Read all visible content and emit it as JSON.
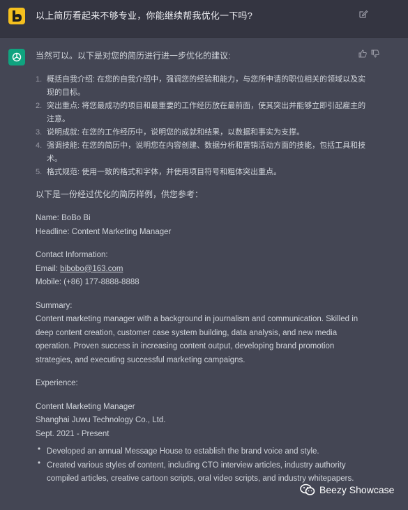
{
  "user_message": {
    "text": "以上简历看起来不够专业，你能继续帮我优化一下吗?"
  },
  "assistant": {
    "intro": "当然可以。以下是对您的简历进行进一步优化的建议:",
    "suggestions": [
      {
        "num": "1.",
        "text": "概括自我介绍: 在您的自我介绍中，强调您的经验和能力，与您所申请的职位相关的领域以及实现的目标。"
      },
      {
        "num": "2.",
        "text": "突出重点: 将您最成功的项目和最重要的工作经历放在最前面，使其突出并能够立即引起雇主的注意。"
      },
      {
        "num": "3.",
        "text": "说明成就: 在您的工作经历中，说明您的成就和结果，以数据和事实为支撑。"
      },
      {
        "num": "4.",
        "text": "强调技能: 在您的简历中，说明您在内容创建、数据分析和营销活动方面的技能，包括工具和技术。"
      },
      {
        "num": "5.",
        "text": "格式规范: 使用一致的格式和字体，并使用项目符号和粗体突出重点。"
      }
    ],
    "sample_intro": "以下是一份经过优化的简历样例，供您参考：",
    "name_line": "Name: BoBo Bi",
    "headline_line": "Headline: Content Marketing Manager",
    "contact_heading": "Contact Information:",
    "email_label": "Email: ",
    "email_value": "bibobo@163.com",
    "mobile_line": "Mobile: (+86) 177-8888-8888",
    "summary_heading": "Summary:",
    "summary_text": "Content marketing manager with a background in journalism and communication. Skilled in deep content creation, customer case system building, data analysis, and new media operation. Proven success in increasing content output, developing brand promotion strategies, and executing successful marketing campaigns.",
    "experience_heading": "Experience:",
    "job_title": "Content Marketing Manager",
    "company": "Shanghai Juwu Technology Co., Ltd.",
    "dates": "Sept. 2021 - Present",
    "bullets": [
      "Developed an annual Message House to establish the brand voice and style.",
      "Created various styles of content, including CTO interview articles, industry authority compiled articles, creative cartoon scripts, oral video scripts, and industry whitepapers."
    ]
  },
  "watermark": {
    "text": "Beezy Showcase"
  },
  "icons": {
    "user_avatar": "beezy-logo-icon",
    "edit": "edit-icon",
    "assistant_avatar": "openai-logo-icon",
    "thumbs_up": "thumbs-up-icon",
    "thumbs_down": "thumbs-down-icon",
    "watermark": "wechat-icon"
  },
  "colors": {
    "user_bg": "#343541",
    "assistant_bg": "#444654",
    "text": "#d1d5db",
    "openai_green": "#10a37f",
    "user_avatar": "#f5c01e"
  }
}
